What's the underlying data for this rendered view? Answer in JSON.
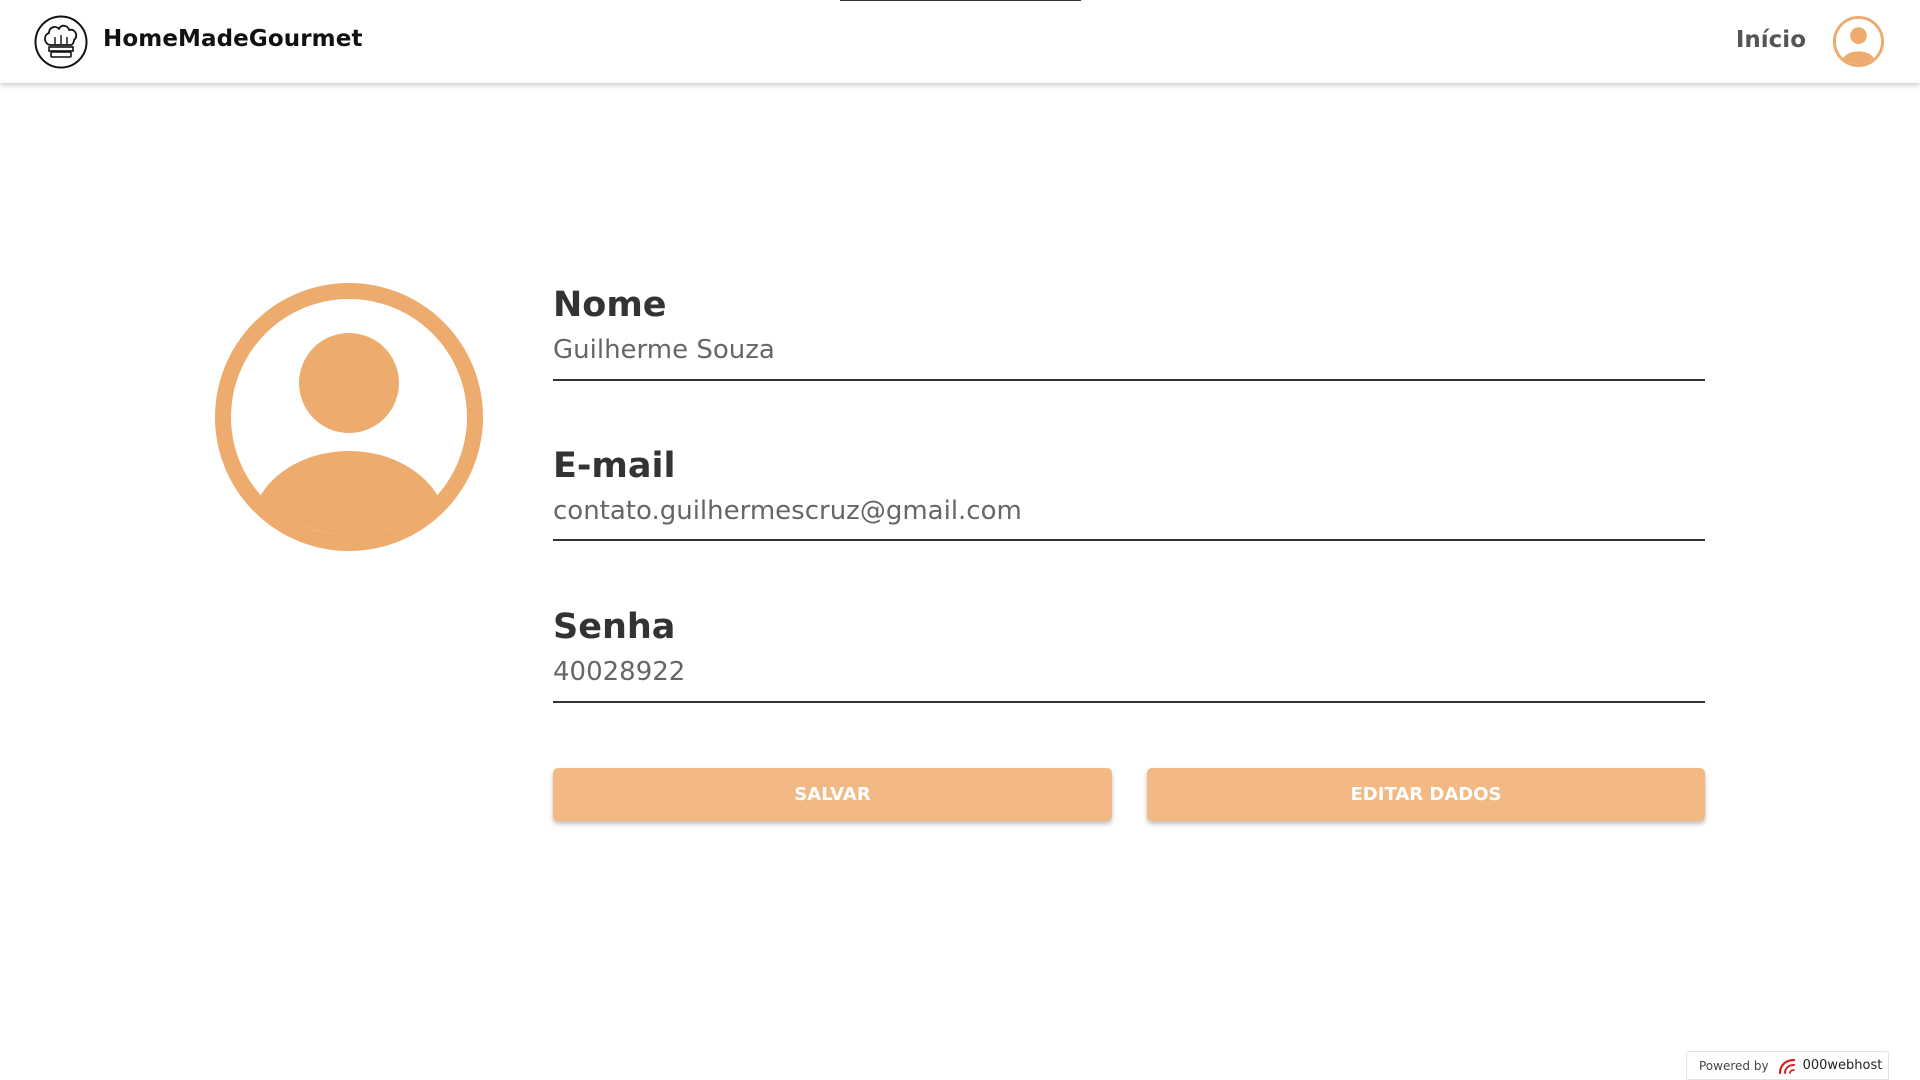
{
  "header": {
    "brand_name": "HomeMadeGourmet",
    "brand_logo_icon": "chef-hat-icon",
    "nav_home_label": "Início",
    "user_icon": "user-avatar-icon"
  },
  "profile": {
    "avatar_icon": "user-avatar-icon",
    "fields": [
      {
        "label": "Nome",
        "value": "Guilherme Souza"
      },
      {
        "label": "E-mail",
        "value": "contato.guilhermescruz@gmail.com"
      },
      {
        "label": "Senha",
        "value": "40028922"
      }
    ]
  },
  "actions": {
    "save_label": "SALVAR",
    "edit_label": "EDITAR DADOS"
  },
  "footer_badge": {
    "powered_by": "Powered by",
    "brand": "000webhost"
  },
  "colors": {
    "accent": "#EDAB6D",
    "button": "#F3B984",
    "text_dark": "#333333",
    "text_value": "#666666"
  }
}
